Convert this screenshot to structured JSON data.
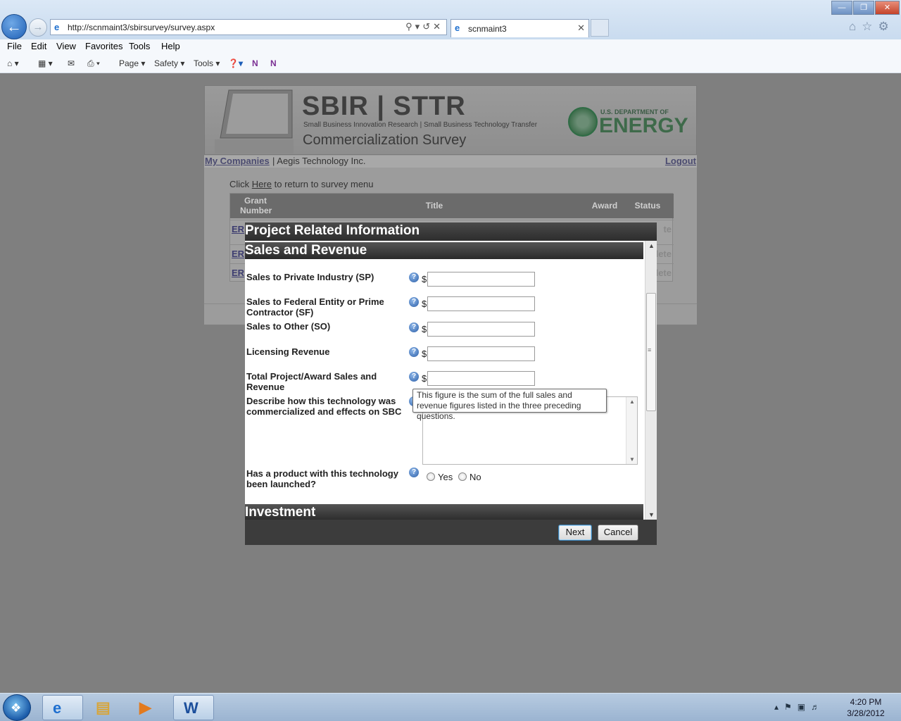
{
  "browser": {
    "url": "http://scnmaint3/sbirsurvey/survey.aspx",
    "tab_title": "scnmaint3",
    "menu": [
      "File",
      "Edit",
      "View",
      "Favorites",
      "Tools",
      "Help"
    ],
    "command_bar": [
      "Page",
      "Safety",
      "Tools"
    ]
  },
  "banner": {
    "heading": "SBIR | STTR",
    "subheading": "Small Business Innovation Research | Small Business Technology Transfer",
    "survey_title": "Commercialization Survey",
    "doe_top": "U.S. DEPARTMENT OF",
    "doe_name": "ENERGY"
  },
  "nav": {
    "my_companies": "My Companies",
    "company_sep": "| Aegis Technology Inc.",
    "logout": "Logout"
  },
  "content": {
    "click_prefix": "Click",
    "here": "Here",
    "click_suffix": "to return to survey menu",
    "table": {
      "headers": [
        "Grant Number",
        "Title",
        "Award",
        "Status"
      ],
      "rows": [
        {
          "grant": "ER",
          "status": "te"
        },
        {
          "grant": "ER",
          "status": "lete"
        },
        {
          "grant": "ER",
          "status": "lete"
        }
      ]
    }
  },
  "modal": {
    "title": "Project Related Information",
    "section_sales": "Sales and Revenue",
    "section_investment": "Investment",
    "questions": {
      "sp": "Sales to Private Industry (SP)",
      "sf": "Sales to Federal Entity or Prime Contractor (SF)",
      "so": "Sales to Other (SO)",
      "lic": "Licensing Revenue",
      "total": "Total Project/Award Sales and Revenue",
      "describe": "Describe how this technology was commercialized and effects on SBC",
      "launched": "Has a product with this technology been launched?"
    },
    "currency": "$",
    "values": {
      "sp": "",
      "sf": "",
      "so": "",
      "lic": "",
      "total": "",
      "describe": ""
    },
    "radio_yes": "Yes",
    "radio_no": "No",
    "tooltip": "This figure is the sum of the full sales and revenue figures listed in the three preceding questions.",
    "next": "Next",
    "cancel": "Cancel"
  },
  "taskbar": {
    "time": "4:20 PM",
    "date": "3/28/2012"
  }
}
